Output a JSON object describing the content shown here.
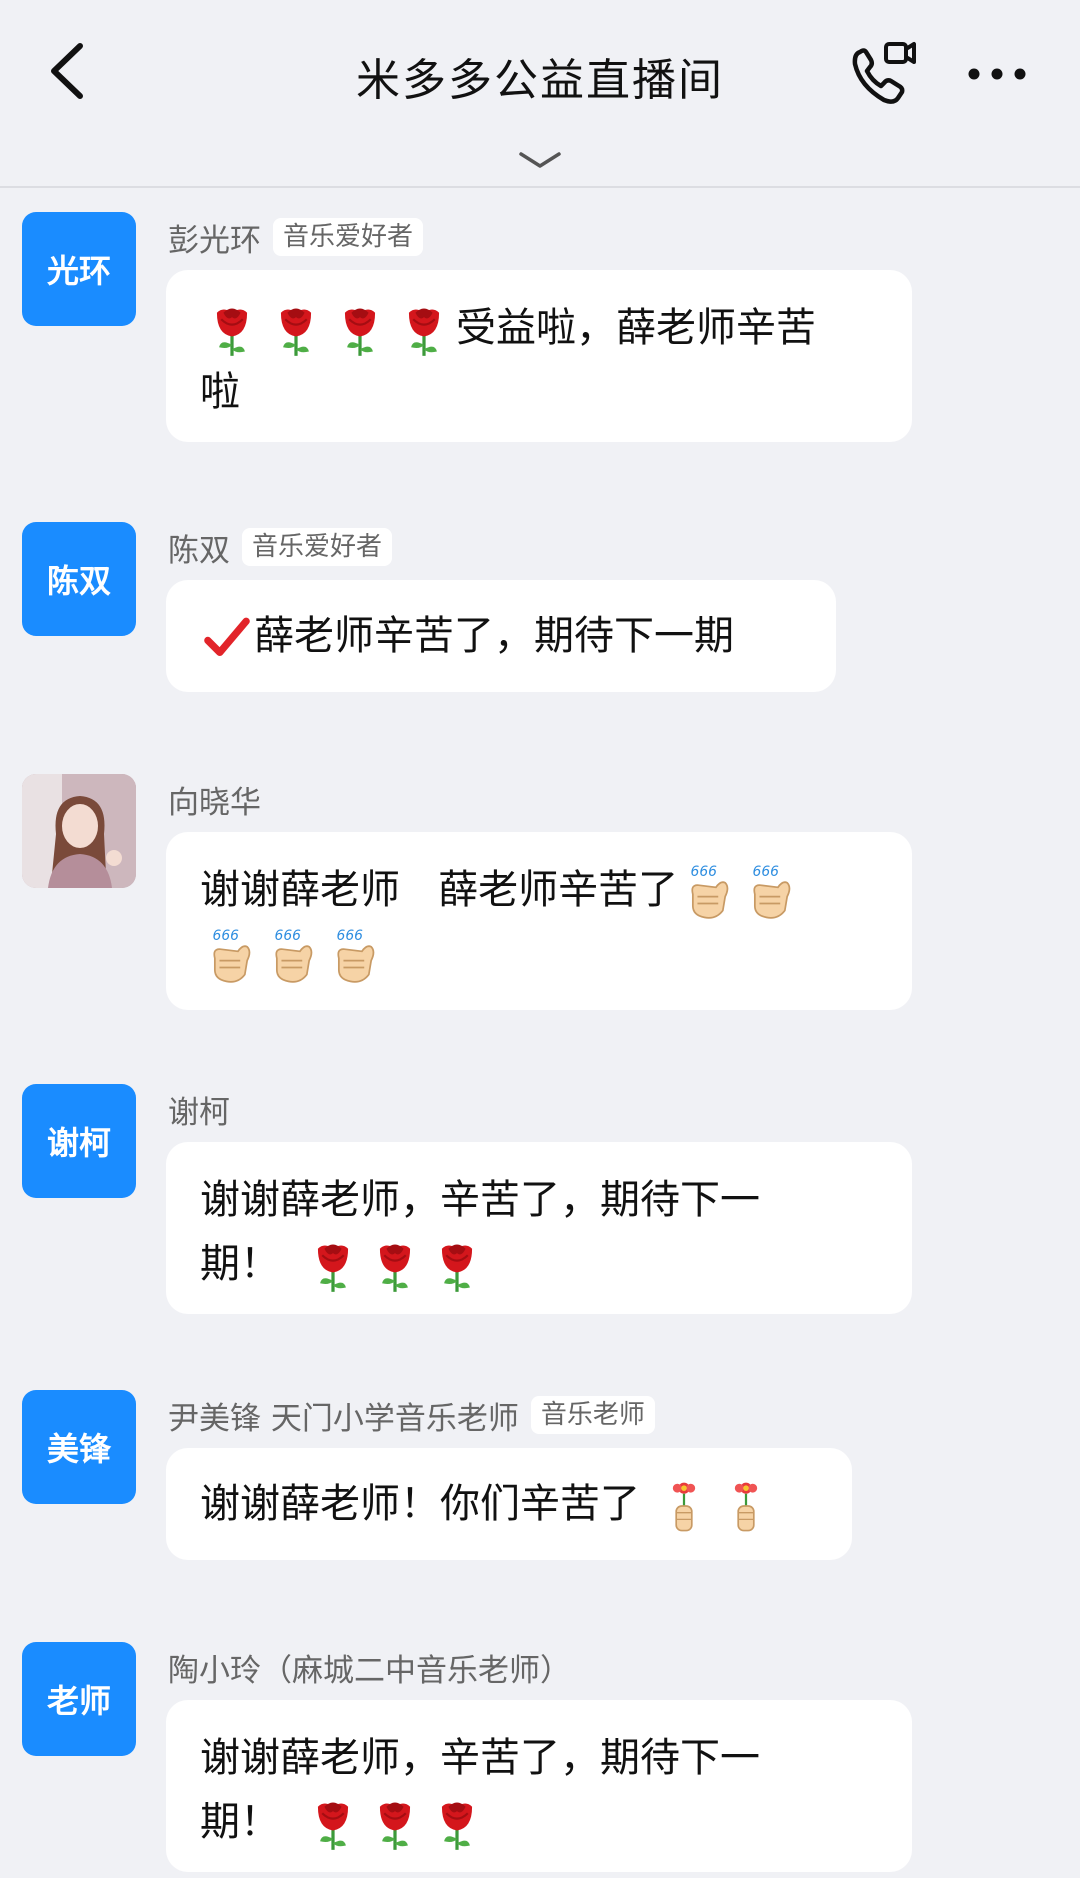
{
  "header": {
    "title": "米多多公益直播间"
  },
  "messages": [
    {
      "avatar_text": "光环",
      "name": "彭光环",
      "badge": "音乐爱好者",
      "text_a": "受益啦，薛老师辛苦",
      "text_b": "啦"
    },
    {
      "avatar_text": "陈双",
      "name": "陈双",
      "badge": "音乐爱好者",
      "text_a": "薛老师辛苦了，期待下一期"
    },
    {
      "avatar_text": "",
      "name": "向晓华",
      "text_a": "谢谢薛老师   薛老师辛苦了"
    },
    {
      "avatar_text": "谢柯",
      "name": "谢柯",
      "text_a": "谢谢薛老师，辛苦了，期待下一",
      "text_b": "期！"
    },
    {
      "avatar_text": "美锋",
      "name": "尹美锋 天门小学音乐老师",
      "badge": "音乐老师",
      "text_a": "谢谢薛老师！你们辛苦了"
    },
    {
      "avatar_text": "老师",
      "name": "陶小玲（麻城二中音乐老师）",
      "text_a": "谢谢薛老师，辛苦了，期待下一",
      "text_b": "期！"
    }
  ]
}
